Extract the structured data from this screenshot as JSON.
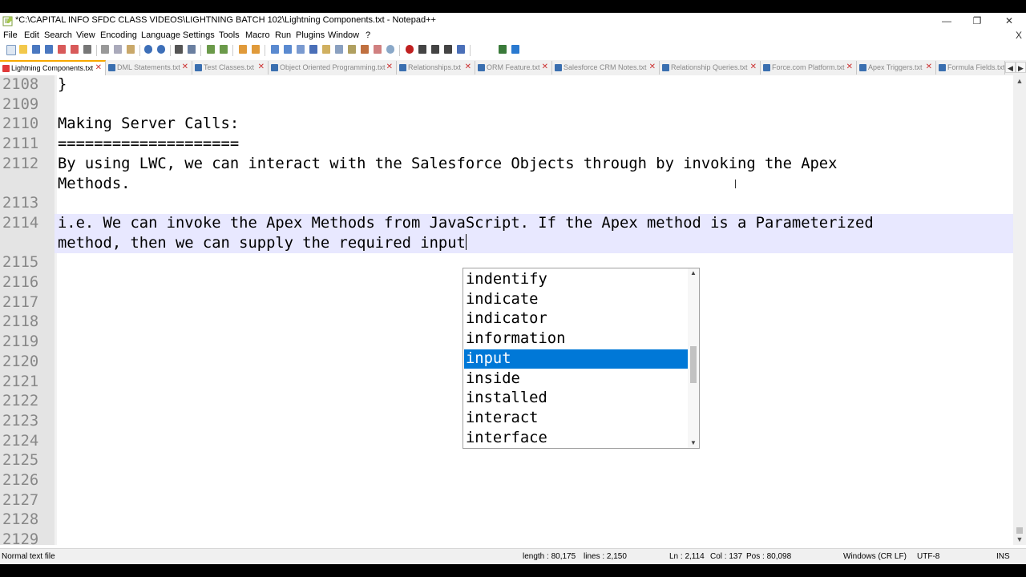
{
  "window": {
    "title": "*C:\\CAPITAL INFO SFDC CLASS VIDEOS\\LIGHTNING BATCH 102\\Lightning Components.txt - Notepad++",
    "min_glyph": "—",
    "max_glyph": "❐",
    "close_glyph": "✕"
  },
  "menu": {
    "items": [
      "File",
      "Edit",
      "Search",
      "View",
      "Encoding",
      "Language",
      "Settings",
      "Tools",
      "Macro",
      "Run",
      "Plugins",
      "Window",
      "?"
    ],
    "close_glyph": "X"
  },
  "tabs": [
    {
      "label": "Lightning Components.txt",
      "active": true
    },
    {
      "label": "DML Statements.txt",
      "active": false
    },
    {
      "label": "Test Classes.txt",
      "active": false
    },
    {
      "label": "Object Oriented Programming.txt",
      "active": false
    },
    {
      "label": "Relationships.txt",
      "active": false
    },
    {
      "label": "ORM Feature.txt",
      "active": false
    },
    {
      "label": "Salesforce CRM Notes.txt",
      "active": false
    },
    {
      "label": "Relationship Queries.txt",
      "active": false
    },
    {
      "label": "Force.com Platform.txt",
      "active": false
    },
    {
      "label": "Apex Triggers.txt",
      "active": false
    },
    {
      "label": "Formula Fields.txt",
      "active": false
    }
  ],
  "editor": {
    "lines": [
      {
        "num": "2108",
        "text": "}"
      },
      {
        "num": "2109",
        "text": ""
      },
      {
        "num": "2110",
        "text": "Making Server Calls:"
      },
      {
        "num": "2111",
        "text": "===================="
      },
      {
        "num": "2112",
        "text": "By using LWC, we can interact with the Salesforce Objects through by invoking the Apex"
      },
      {
        "num": "",
        "text": "Methods."
      },
      {
        "num": "2113",
        "text": ""
      },
      {
        "num": "2114",
        "text": "i.e. We can invoke the Apex Methods from JavaScript. If the Apex method is a Parameterized"
      },
      {
        "num": "",
        "text": "method, then we can supply the required input"
      },
      {
        "num": "2115",
        "text": ""
      },
      {
        "num": "2116",
        "text": ""
      },
      {
        "num": "2117",
        "text": ""
      },
      {
        "num": "2118",
        "text": ""
      },
      {
        "num": "2119",
        "text": ""
      },
      {
        "num": "2120",
        "text": ""
      },
      {
        "num": "2121",
        "text": ""
      },
      {
        "num": "2122",
        "text": ""
      },
      {
        "num": "2123",
        "text": ""
      },
      {
        "num": "2124",
        "text": ""
      },
      {
        "num": "2125",
        "text": ""
      },
      {
        "num": "2126",
        "text": ""
      },
      {
        "num": "2127",
        "text": ""
      },
      {
        "num": "2128",
        "text": ""
      },
      {
        "num": "2129",
        "text": ""
      }
    ]
  },
  "autocomplete": {
    "items": [
      "indentify",
      "indicate",
      "indicator",
      "information",
      "input",
      "inside",
      "installed",
      "interact",
      "interface"
    ],
    "selected": "input"
  },
  "status": {
    "file_type": "Normal text file",
    "length": "length : 80,175",
    "lines": "lines : 2,150",
    "ln": "Ln : 2,114",
    "col": "Col : 137",
    "pos": "Pos : 80,098",
    "eol": "Windows (CR LF)",
    "encoding": "UTF-8",
    "mode": "INS"
  },
  "colors": {
    "accent": "#0078d7",
    "line_highlight": "#e8e8ff",
    "active_tab_border": "#f7a800"
  }
}
